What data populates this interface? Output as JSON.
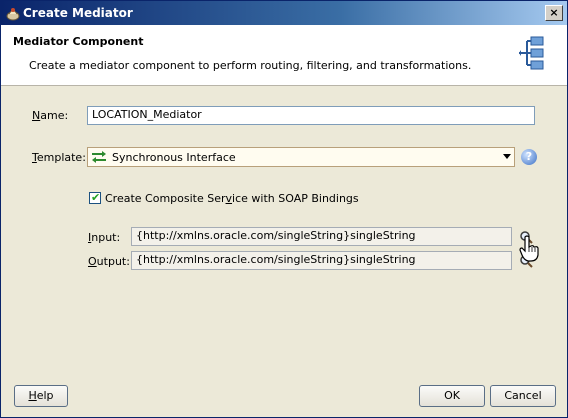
{
  "window": {
    "title": "Create Mediator",
    "close_label": "×"
  },
  "header": {
    "title": "Mediator Component",
    "description": "Create a mediator component to perform routing, filtering, and transformations."
  },
  "form": {
    "name_label_pre": "",
    "name_label_u": "N",
    "name_label_post": "ame:",
    "name_value": "LOCATION_Mediator",
    "template_label_u": "T",
    "template_label_post": "emplate:",
    "template_value": "Synchronous Interface",
    "help_glyph": "?",
    "checkbox_label_pre": "Create Composite Ser",
    "checkbox_label_u": "v",
    "checkbox_label_post": "ice with SOAP Bindings",
    "checkbox_checked": true,
    "input_label_u": "I",
    "input_label_post": "nput:",
    "input_value": "{http://xmlns.oracle.com/singleString}singleString",
    "output_label_u": "O",
    "output_label_post": "utput:",
    "output_value": "{http://xmlns.oracle.com/singleString}singleString"
  },
  "buttons": {
    "help_pre": "",
    "help_u": "H",
    "help_post": "elp",
    "ok": "OK",
    "cancel": "Cancel"
  },
  "icons": {
    "title": "mediator-cup-icon",
    "logo": "mediator-component-icon",
    "template": "sync-arrows-icon",
    "browse": "magnifier-icon",
    "cursor": "hand-cursor-icon"
  },
  "colors": {
    "titlebar": "#0a246a",
    "dialog_bg": "#ece9d8",
    "header_bg": "#ffffff"
  }
}
